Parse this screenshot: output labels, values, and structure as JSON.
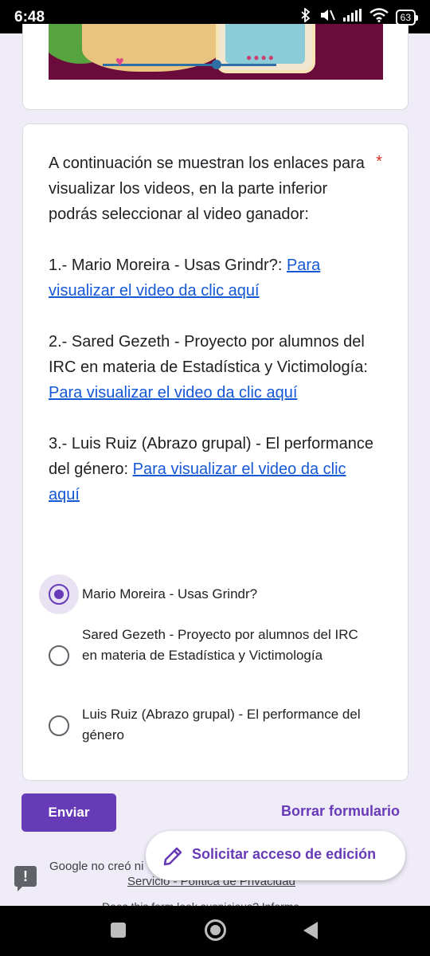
{
  "status_bar": {
    "time": "6:48",
    "battery": "63",
    "icons": [
      "bluetooth-icon",
      "mute-icon",
      "signal-icon",
      "wifi-icon",
      "battery-icon"
    ]
  },
  "question": {
    "paragraphs": [
      "A continuación se muestran los enlaces para visualizar los videos, en la parte inferior podrás seleccionar al video ganador:"
    ],
    "items": [
      {
        "prefix": "1.- Mario Moreira - Usas Grindr?: ",
        "link": "Para visualizar el video da clic aquí"
      },
      {
        "prefix": "2.- Sared Gezeth -  Proyecto por alumnos del IRC en materia de Estadística y Victimología: ",
        "link": "Para visualizar el video da clic aquí"
      },
      {
        "prefix": "3.- Luis Ruiz (Abrazo grupal) - El performance del género: ",
        "link": "Para visualizar el video da clic aquí"
      }
    ],
    "required_marker": "*"
  },
  "options": [
    {
      "label": "Mario Moreira - Usas Grindr?",
      "selected": true
    },
    {
      "label": "Sared Gezeth  -  Proyecto por alumnos del IRC en materia de Estadística y Victimología",
      "selected": false
    },
    {
      "label": "Luis Ruiz (Abrazo grupal) - El performance del género",
      "selected": false
    }
  ],
  "actions": {
    "submit_label": "Enviar",
    "clear_label": "Borrar formulario",
    "fab_label": "Solicitar acceso de edición"
  },
  "footer": {
    "text": "Google no creó ni",
    "links": "Servicio - Política de Privacidad",
    "more": "Does this form look suspicious? Informe"
  },
  "colors": {
    "accent": "#673ab7",
    "link": "#1558d6",
    "required": "#d93025",
    "background": "#efebf7"
  }
}
